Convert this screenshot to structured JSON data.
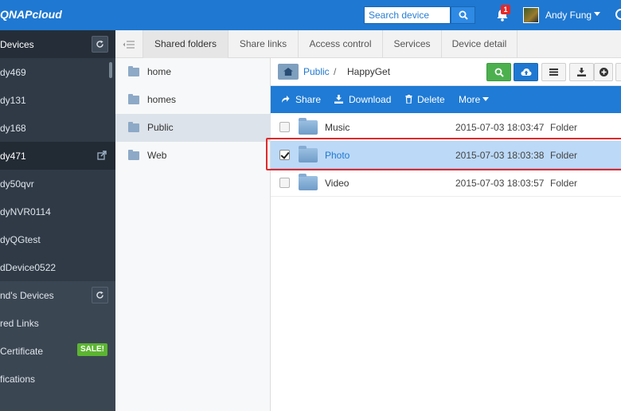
{
  "app": {
    "brand": "QNAPcloud"
  },
  "header": {
    "search": {
      "placeholder": "Search device",
      "value": ""
    },
    "notifications": {
      "count": "1"
    },
    "user": {
      "name": "Andy Fung"
    }
  },
  "sidebar": {
    "section_title": "Devices",
    "devices": [
      {
        "label": "dy469"
      },
      {
        "label": "dy131"
      },
      {
        "label": "dy168"
      },
      {
        "label": "dy471",
        "active": true
      },
      {
        "label": "dy50qvr"
      },
      {
        "label": "dyNVR0114"
      },
      {
        "label": "dyQGtest"
      },
      {
        "label": "dDevice0522"
      }
    ],
    "lower": [
      {
        "label": "nd's Devices"
      },
      {
        "label": "red Links"
      },
      {
        "label": " Certificate",
        "badge": "SALE!"
      },
      {
        "label": "fications"
      }
    ]
  },
  "tabs": [
    {
      "label": "Shared folders",
      "active": true
    },
    {
      "label": "Share links"
    },
    {
      "label": "Access control"
    },
    {
      "label": "Services"
    },
    {
      "label": "Device detail"
    }
  ],
  "tree": [
    {
      "label": "home"
    },
    {
      "label": "homes"
    },
    {
      "label": "Public",
      "active": true
    },
    {
      "label": "Web"
    }
  ],
  "breadcrumb": {
    "root": "Public",
    "separator": "/",
    "current": "HappyGet"
  },
  "actions": {
    "share": "Share",
    "download": "Download",
    "delete": "Delete",
    "more": "More"
  },
  "files": [
    {
      "name": "Music",
      "modified": "2015-07-03 18:03:47",
      "type": "Folder",
      "checked": false
    },
    {
      "name": "Photo",
      "modified": "2015-07-03 18:03:38",
      "type": "Folder",
      "checked": true
    },
    {
      "name": "Video",
      "modified": "2015-07-03 18:03:57",
      "type": "Folder",
      "checked": false
    }
  ],
  "colors": {
    "header": "#1f78d1",
    "sidebar": "#2f3a46",
    "action_bar": "#1f7bd5",
    "selected_row": "#bcd9f7",
    "highlight": "#e02a2a",
    "sale_badge": "#5cb531"
  }
}
